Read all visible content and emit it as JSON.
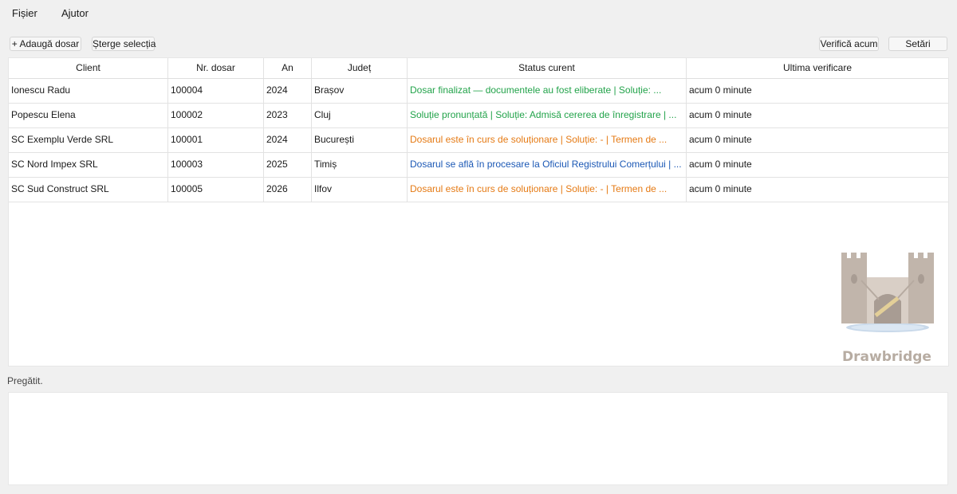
{
  "menu": {
    "file": "Fișier",
    "help": "Ajutor"
  },
  "toolbar": {
    "add_label": "+ Adaugă dosar",
    "delete_label": "Șterge selecția",
    "check_label": "Verifică acum",
    "settings_label": "Setări"
  },
  "table": {
    "headers": [
      "Client",
      "Nr. dosar",
      "An",
      "Județ",
      "Status curent",
      "Ultima verificare"
    ],
    "rows": [
      {
        "client": "Ionescu Radu",
        "nr": "100004",
        "an": "2024",
        "judet": "Brașov",
        "status": "Dosar finalizat — documentele au fost eliberate | Soluție: ...",
        "status_color": "#22a34a",
        "verificare": "acum 0 minute"
      },
      {
        "client": "Popescu Elena",
        "nr": "100002",
        "an": "2023",
        "judet": "Cluj",
        "status": "Soluție pronunțată | Soluție: Admisă cererea de înregistrare | ...",
        "status_color": "#22a34a",
        "verificare": "acum 0 minute"
      },
      {
        "client": "SC Exemplu Verde SRL",
        "nr": "100001",
        "an": "2024",
        "judet": "București",
        "status": "Dosarul este în curs de soluționare | Soluție: - | Termen de ...",
        "status_color": "#e57a14",
        "verificare": "acum 0 minute"
      },
      {
        "client": "SC Nord Impex SRL",
        "nr": "100003",
        "an": "2025",
        "judet": "Timiș",
        "status": "Dosarul se află în procesare la Oficiul Registrului Comerțului | ...",
        "status_color": "#1b58b5",
        "verificare": "acum 0 minute"
      },
      {
        "client": "SC Sud Construct SRL",
        "nr": "100005",
        "an": "2026",
        "judet": "Ilfov",
        "status": "Dosarul este în curs de soluționare | Soluție: - | Termen de ...",
        "status_color": "#e57a14",
        "verificare": "acum 0 minute"
      }
    ]
  },
  "logo": {
    "text": "Drawbridge",
    "icon": "castle-icon"
  },
  "status_bar": {
    "text": "Pregătit."
  },
  "log": {
    "text": ""
  }
}
